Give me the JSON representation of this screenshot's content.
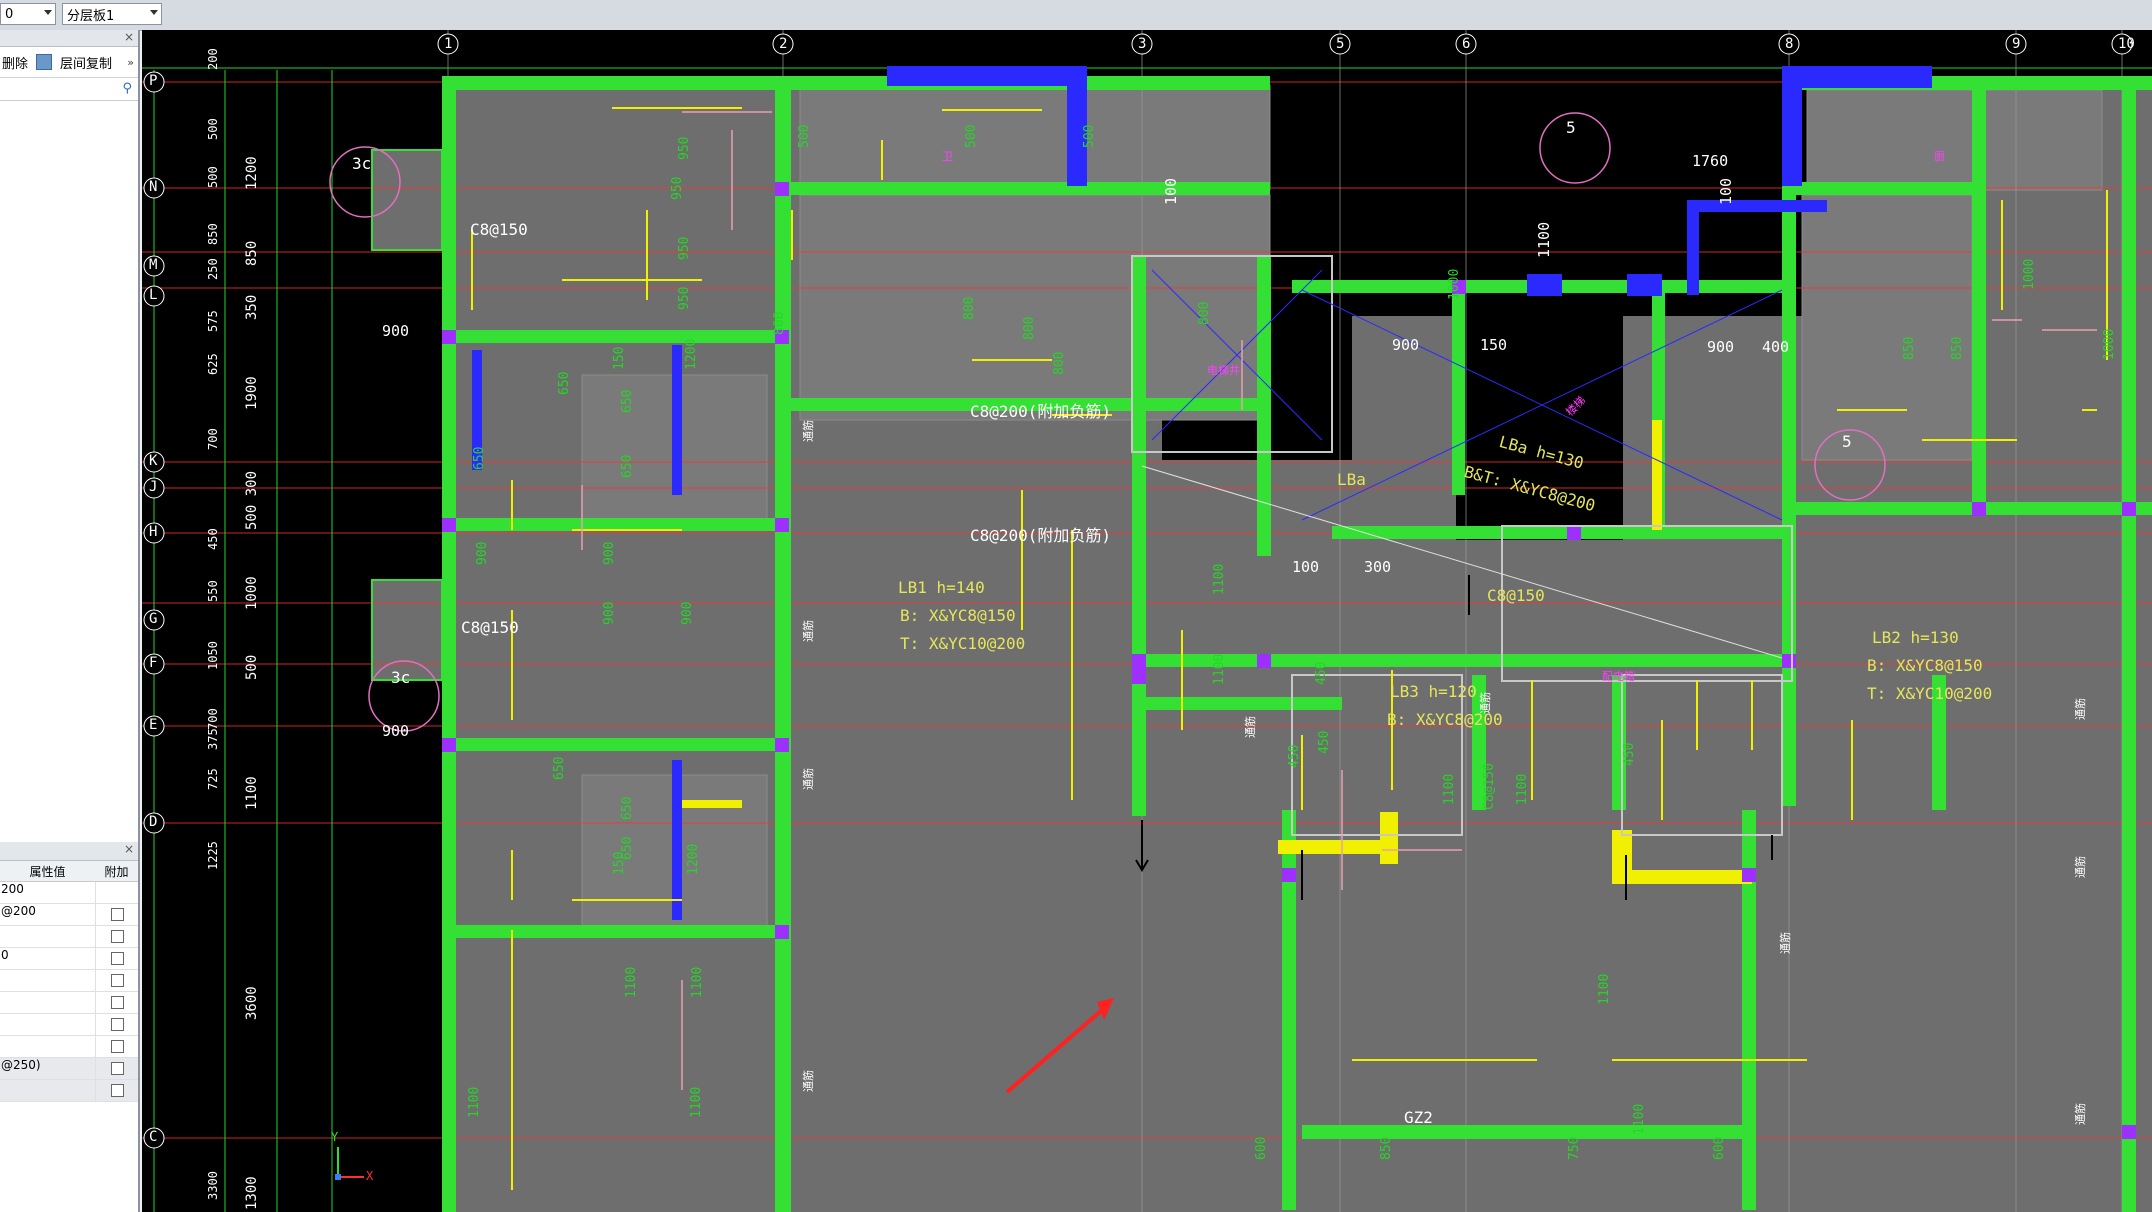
{
  "toolbar": {
    "floor_combo_value": "0",
    "layer_combo_value": "分层板1"
  },
  "sidebar": {
    "tools": {
      "delete_label": "删除",
      "copy_label": "层间复制"
    },
    "props": {
      "col_value": "属性值",
      "col_extra": "附加",
      "rows": [
        {
          "value": "200",
          "check": false
        },
        {
          "value": "@200",
          "check": true
        },
        {
          "value": "",
          "check": true
        },
        {
          "value": "0",
          "check": true
        },
        {
          "value": "",
          "check": true
        },
        {
          "value": "",
          "check": true
        },
        {
          "value": "",
          "check": true
        },
        {
          "value": "",
          "check": true
        },
        {
          "value": "@250)",
          "check": true
        },
        {
          "value": "",
          "check": true
        }
      ]
    }
  },
  "cad": {
    "axis_top": [
      "1",
      "2",
      "3",
      "5",
      "6",
      "8",
      "9",
      "10"
    ],
    "axis_left": [
      "P",
      "N",
      "M",
      "L",
      "K",
      "J",
      "H",
      "G",
      "F",
      "E",
      "D",
      "C"
    ],
    "dims_left_outer": [
      "1200",
      "850",
      "350",
      "1900",
      "500 300",
      "1000",
      "500",
      "1100",
      "3600",
      "1300"
    ],
    "dims_left_inner": [
      "200",
      "500",
      "500",
      "850",
      "250",
      "575",
      "625",
      "700",
      "450",
      "550",
      "1050",
      "700",
      "375",
      "725",
      "1225",
      "3300"
    ],
    "slab_labels": [
      {
        "text": "LB1  h=140",
        "color": "#e6e65a"
      },
      {
        "text": "B: X&YC8@150",
        "color": "#e6e65a"
      },
      {
        "text": "T: X&YC10@200",
        "color": "#e6e65a"
      },
      {
        "text": "LB2  h=130",
        "color": "#e6e65a"
      },
      {
        "text": "B: X&YC8@150",
        "color": "#e6e65a"
      },
      {
        "text": "T: X&YC10@200",
        "color": "#e6e65a"
      },
      {
        "text": "LB3  h=120",
        "color": "#e6e65a"
      },
      {
        "text": "B: X&YC8@200",
        "color": "#e6e65a"
      },
      {
        "text": "LBa  h=130",
        "color": "#e6e65a"
      },
      {
        "text": "B&T: X&YC8@200",
        "color": "#e6e65a"
      },
      {
        "text": "LBa",
        "color": "#e6e65a"
      },
      {
        "text": "C8@200(附加负筋)",
        "color": "#ffffff"
      },
      {
        "text": "C8@200(附加负筋)",
        "color": "#ffffff"
      },
      {
        "text": "C8@150",
        "color": "#ffffff"
      },
      {
        "text": "C8@150",
        "color": "#ffffff"
      },
      {
        "text": "C8@150",
        "color": "#e6e65a"
      },
      {
        "text": "GZ2",
        "color": "#ffffff"
      }
    ],
    "rebar_numbers": [
      "950",
      "950",
      "950",
      "950",
      "800",
      "800",
      "800",
      "800",
      "800",
      "500",
      "500",
      "500",
      "650",
      "650",
      "650",
      "650",
      "150",
      "1200",
      "900",
      "900",
      "900",
      "900",
      "650",
      "650",
      "650",
      "150",
      "1200",
      "1100",
      "1100",
      "1100",
      "1100",
      "1100",
      "1100",
      "450",
      "450",
      "450",
      "450",
      "1000",
      "1000",
      "1000",
      "850",
      "850",
      "1100",
      "1100",
      "C8@150",
      "1100",
      "1100",
      "600",
      "850",
      "750",
      "600"
    ],
    "annot_numbers": [
      "900",
      "900",
      "1760",
      "900",
      "150",
      "900",
      "400",
      "100",
      "300",
      "1100",
      "100",
      "100"
    ],
    "magenta_labels": [
      "电梯井",
      "楼梯",
      "配电箱",
      "卫",
      "厨"
    ],
    "wall_tags": [
      "通筋",
      "通筋",
      "通筋",
      "通筋",
      "通筋",
      "通筋",
      "通筋",
      "通筋",
      "通筋",
      "通筋"
    ],
    "circles": [
      "3c",
      "3c",
      "5",
      "5"
    ],
    "ucs": {
      "y": "Y",
      "x": "X"
    }
  }
}
